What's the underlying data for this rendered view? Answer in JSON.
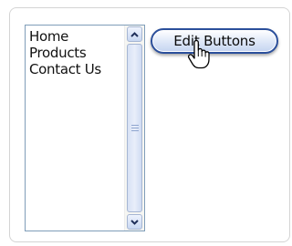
{
  "menu_list": {
    "items": [
      "Home",
      "Products",
      "Contact Us"
    ]
  },
  "scrollbar": {
    "up_icon": "triangle-up",
    "down_icon": "triangle-down",
    "grip_icon": "scroll-grip"
  },
  "edit_button": {
    "label": "Edit Buttons"
  },
  "cursor": {
    "icon": "hand-pointer"
  },
  "colors": {
    "button_border": "#2b4f9b",
    "listbox_border": "#7f9db9"
  }
}
